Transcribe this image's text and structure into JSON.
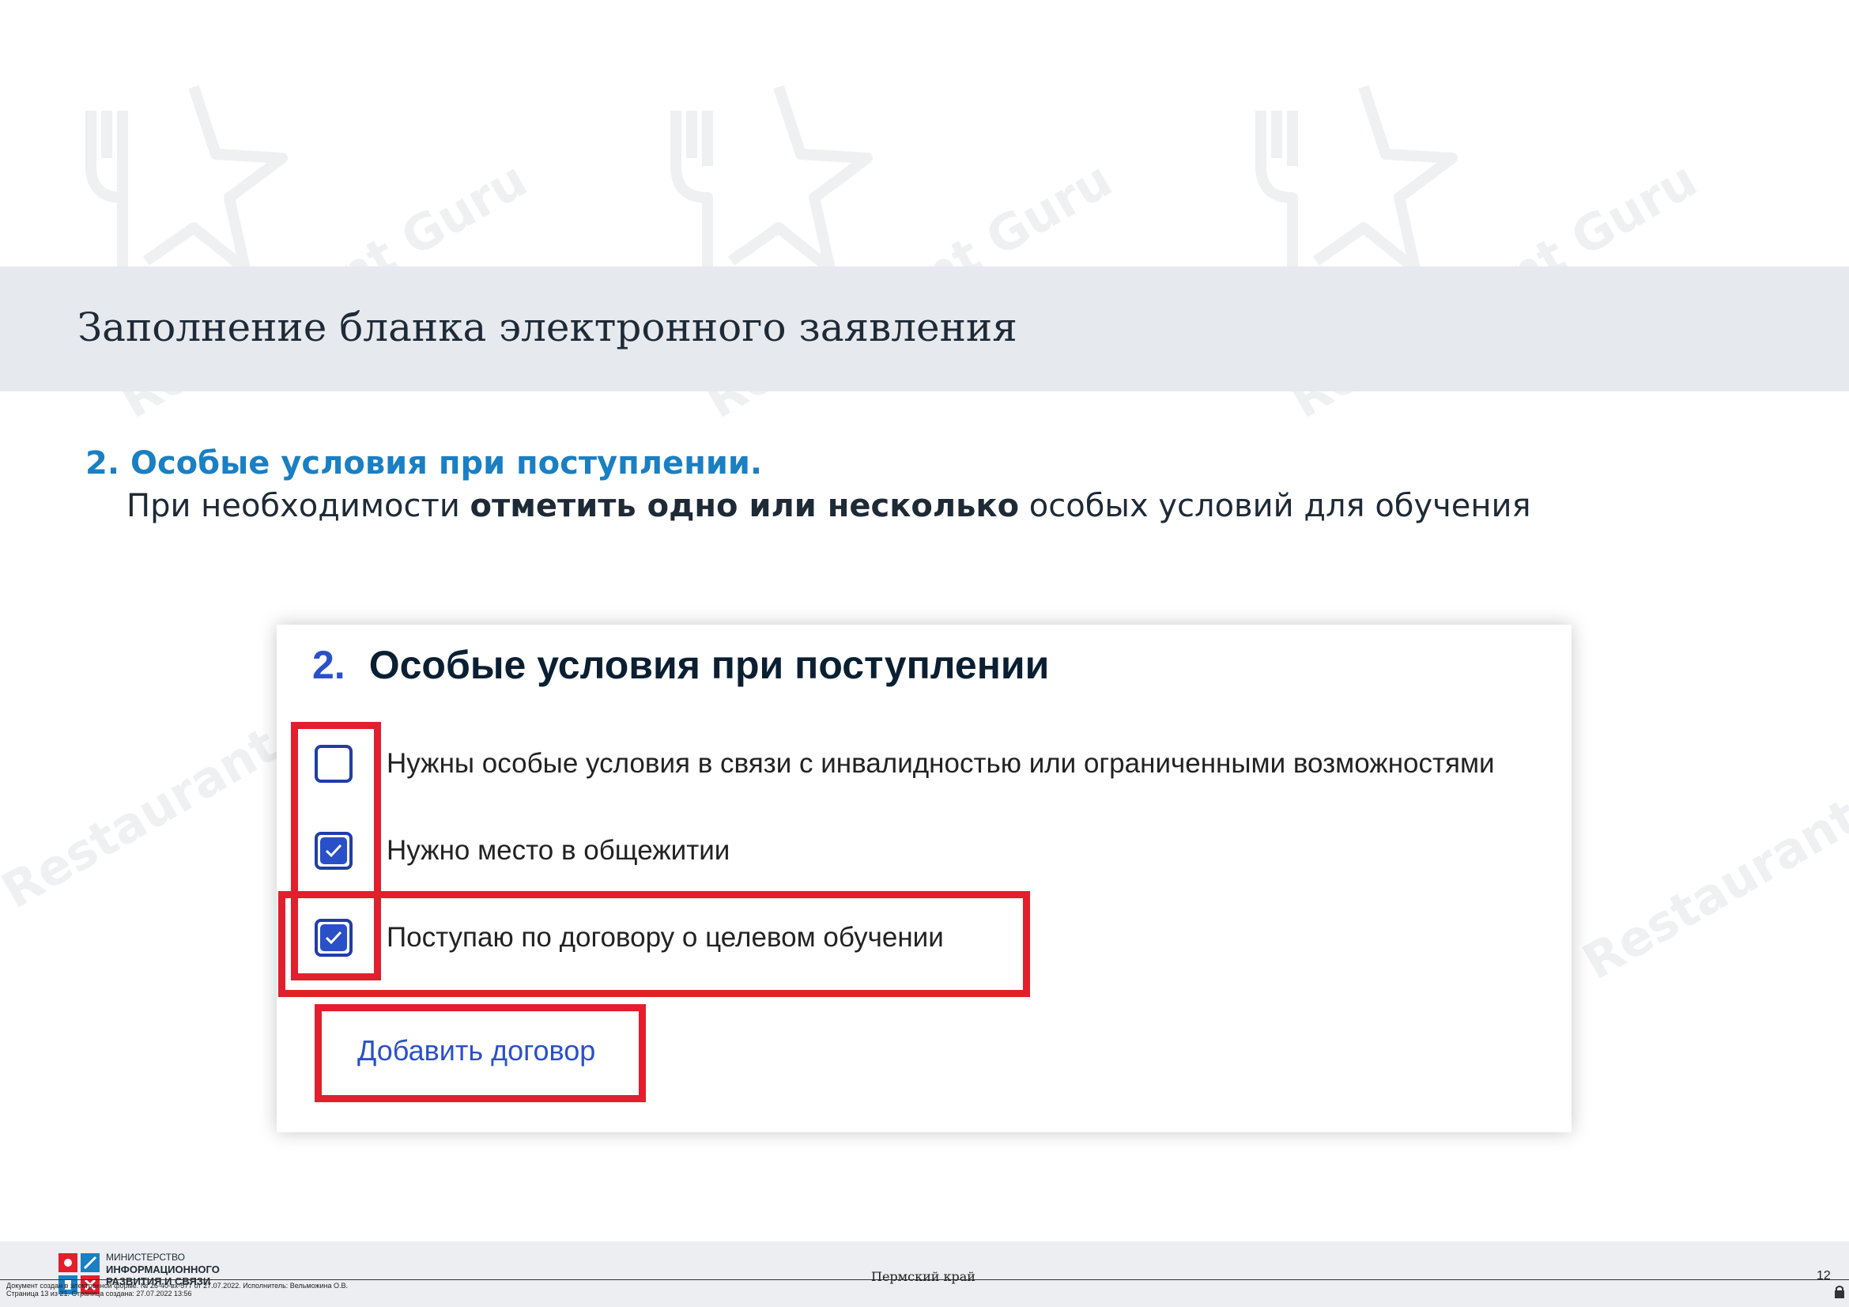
{
  "slide": {
    "title": "Заполнение бланка электронного заявления",
    "step_heading": "2. Особые условия при поступлении.",
    "step_desc_part1": "При необходимости ",
    "step_desc_bold": "отметить одно или несколько",
    "step_desc_part2": " особых условий для обучения"
  },
  "form": {
    "section_number": "2.",
    "section_title": "Особые условия при поступлении",
    "options": [
      {
        "label": "Нужны особые условия в связи с инвалидностью или ограниченными возможностями",
        "checked": false
      },
      {
        "label": "Нужно место в общежитии",
        "checked": true
      },
      {
        "label": "Поступаю по договору о целевом обучении",
        "checked": true
      }
    ],
    "add_contract_link": "Добавить договор"
  },
  "footer": {
    "ministry_line1": "МИНИСТЕРСТВО",
    "ministry_line2": "ИНФОРМАЦИОННОГО",
    "ministry_line3": "РАЗВИТИЯ И СВЯЗИ",
    "region": "Пермский край",
    "page_number": "12",
    "doc_note_line1": "Документ создан в электронной форме. № 26-40-вх-577 от 27.07.2022. Исполнитель: Вельможина О.В.",
    "doc_note_line2": "Страница 13 из 21. Страница создана: 27.07.2022 13:56"
  },
  "watermark": {
    "text": "Restaurant Guru"
  },
  "colors": {
    "accent_blue": "#1a7fc3",
    "form_blue": "#2b50c8",
    "highlight_red": "#e31e2d",
    "title_band": "#e6e9ee"
  }
}
